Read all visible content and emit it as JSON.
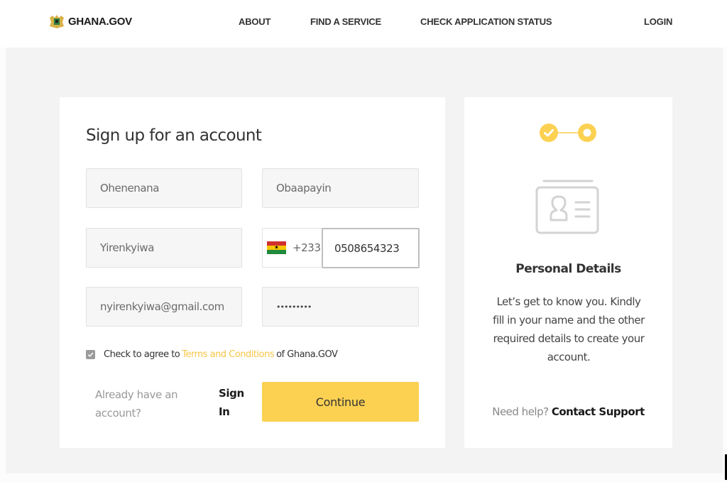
{
  "header": {
    "logo_text": "GHANA.GOV",
    "nav": {
      "about": "ABOUT",
      "find_service": "FIND A SERVICE",
      "check_status": "CHECK APPLICATION STATUS",
      "login": "LOGIN"
    }
  },
  "form": {
    "title": "Sign up for an account",
    "fields": {
      "first_name": "Ohenenana",
      "last_name": "Obaapayin",
      "other_name": "Yirenkyiwa",
      "country_dial_code": "+233",
      "phone": "0508654323",
      "email": "nyirenkyiwa@gmail.com",
      "password_masked": "•••••••••"
    },
    "terms": {
      "checked": true,
      "prefix": "Check to agree to",
      "link": "Terms and Conditions",
      "suffix": "of Ghana.GOV"
    },
    "already_have_account": "Already have an account?",
    "sign_in_label": "Sign In",
    "continue_label": "Continue"
  },
  "side_panel": {
    "steps": {
      "total": 2,
      "completed": 1,
      "current": 2
    },
    "title": "Personal Details",
    "description": "Let’s get to know you. Kindly fill in your name and the other required details to create your account.",
    "help_prefix": "Need help?",
    "help_link": "Contact Support"
  },
  "colors": {
    "accent": "#fcd152",
    "link": "#f7c64a",
    "background": "#f3f3f3"
  },
  "icons": {
    "logo": "ghana-coat-of-arms-icon",
    "flag": "ghana-flag-icon",
    "step_done": "check-circle-icon",
    "step_current": "ring-circle-icon",
    "id_card": "id-card-icon"
  }
}
